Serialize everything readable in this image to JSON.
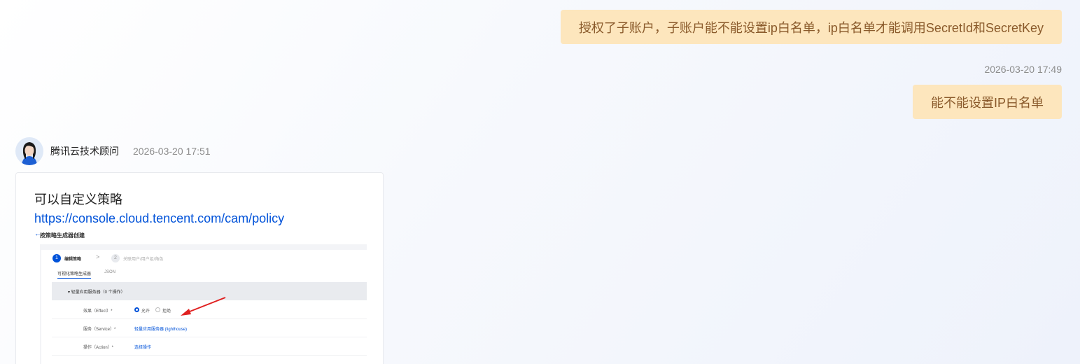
{
  "messages": {
    "user_1": "授权了子账户，子账户能不能设置ip白名单，ip白名单才能调用SecretId和SecretKey",
    "user_2_time": "2026-03-20 17:49",
    "user_2": "能不能设置IP白名单"
  },
  "agent": {
    "name": "腾讯云技术顾问",
    "time": "2026-03-20 17:51",
    "reply_text": "可以自定义策略",
    "reply_link": "https://console.cloud.tencent.com/cam/policy"
  },
  "screenshot": {
    "back_arrow": "←",
    "title": "按策略生成器创建",
    "step1_num": "1",
    "step1": "编辑策略",
    "chevron": ">",
    "step2_num": "2",
    "step2": "关联用户/用户组/角色",
    "tab_visual": "可视化策略生成器",
    "tab_json": "JSON",
    "section": "▾ 轻量应用服务器（0 个操作）",
    "effect_label": "效果（Effect）*",
    "effect_allow": "允许",
    "effect_deny": "拒绝",
    "service_label": "服务（Service）*",
    "service_value": "轻量应用服务器 (lighthouse)",
    "action_label": "操作（Action）*",
    "action_value": "选择操作"
  },
  "colors": {
    "user_bubble": "#fde6bd",
    "user_text": "#8a5a2b",
    "link": "#0052d9",
    "arrow": "#e02020"
  }
}
